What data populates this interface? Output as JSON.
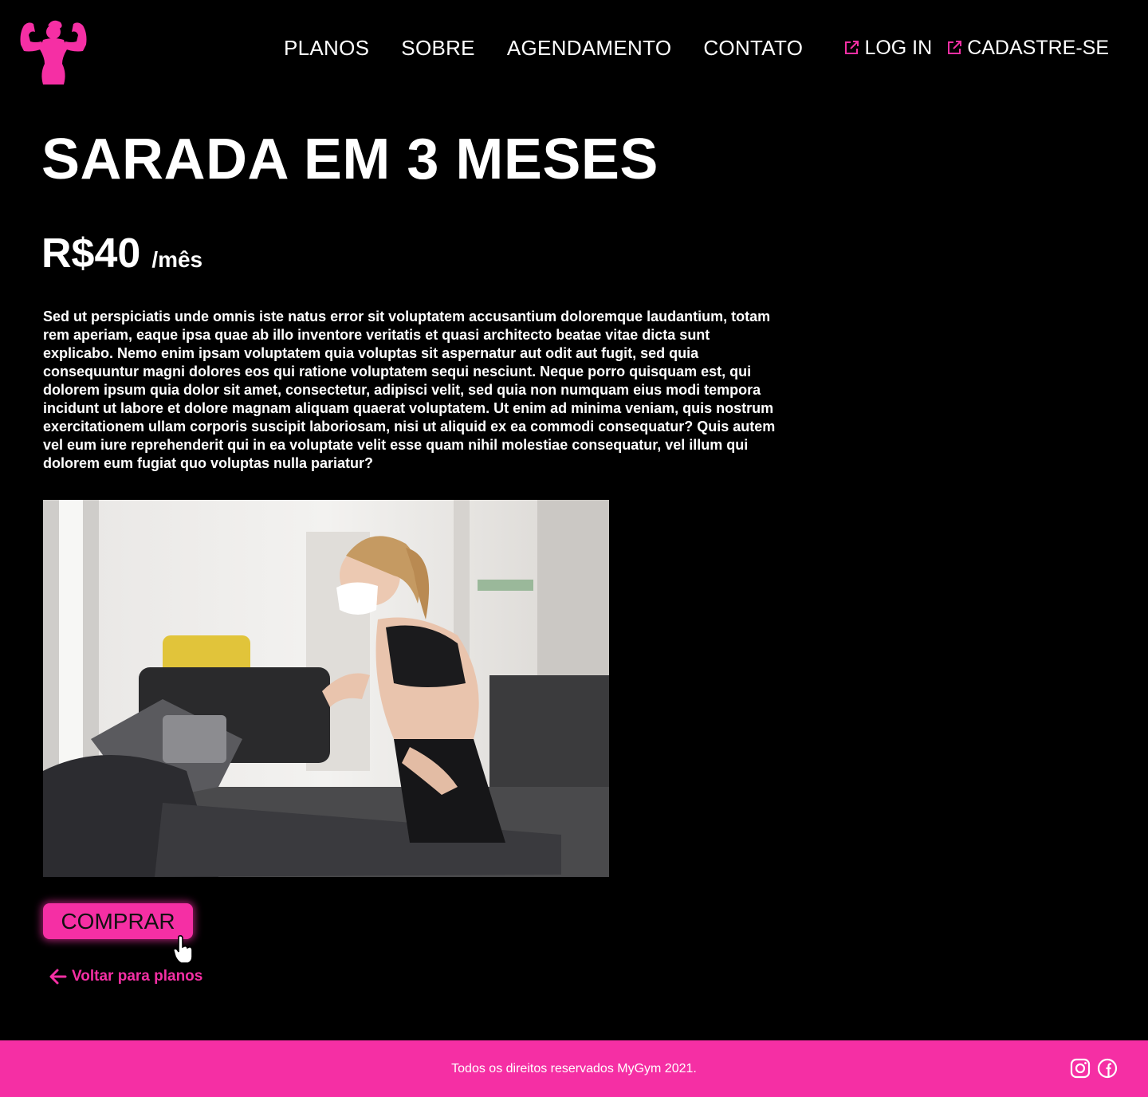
{
  "brand": {
    "name": "MyGym",
    "accent_color": "#f52fa4",
    "logo_icon": "flexing-woman-icon"
  },
  "nav": {
    "items": [
      {
        "label": "PLANOS"
      },
      {
        "label": "SOBRE"
      },
      {
        "label": "AGENDAMENTO"
      },
      {
        "label": "CONTATO"
      }
    ]
  },
  "auth": {
    "login_label": "LOG IN",
    "signup_label": "CADASTRE-SE",
    "icon": "external-link-icon"
  },
  "plan": {
    "title": "SARADA EM 3 MESES",
    "price": "R$40",
    "period": "/mês",
    "description": "Sed ut perspiciatis unde omnis iste natus error sit voluptatem accusantium doloremque laudantium, totam rem aperiam, eaque ipsa quae ab illo inventore veritatis et quasi architecto beatae vitae dicta sunt explicabo. Nemo enim ipsam voluptatem quia voluptas sit aspernatur aut odit aut fugit, sed quia consequuntur magni dolores eos qui ratione voluptatem sequi nesciunt. Neque porro quisquam est, qui dolorem ipsum quia dolor sit amet, consectetur, adipisci velit, sed quia non numquam eius modi tempora incidunt ut labore et dolore magnam aliquam quaerat voluptatem. Ut enim ad minima veniam, quis nostrum exercitationem ullam corporis suscipit laboriosam, nisi ut aliquid ex ea commodi consequatur? Quis autem vel eum iure reprehenderit qui in ea voluptate velit esse quam nihil molestiae consequatur, vel illum qui dolorem eum fugiat quo voluptas nulla pariatur?",
    "buy_label": "COMPRAR",
    "back_label": "Voltar para planos"
  },
  "footer": {
    "copyright": "Todos os direitos reservados MyGym 2021.",
    "social_icons": [
      "instagram-icon",
      "facebook-icon"
    ]
  }
}
